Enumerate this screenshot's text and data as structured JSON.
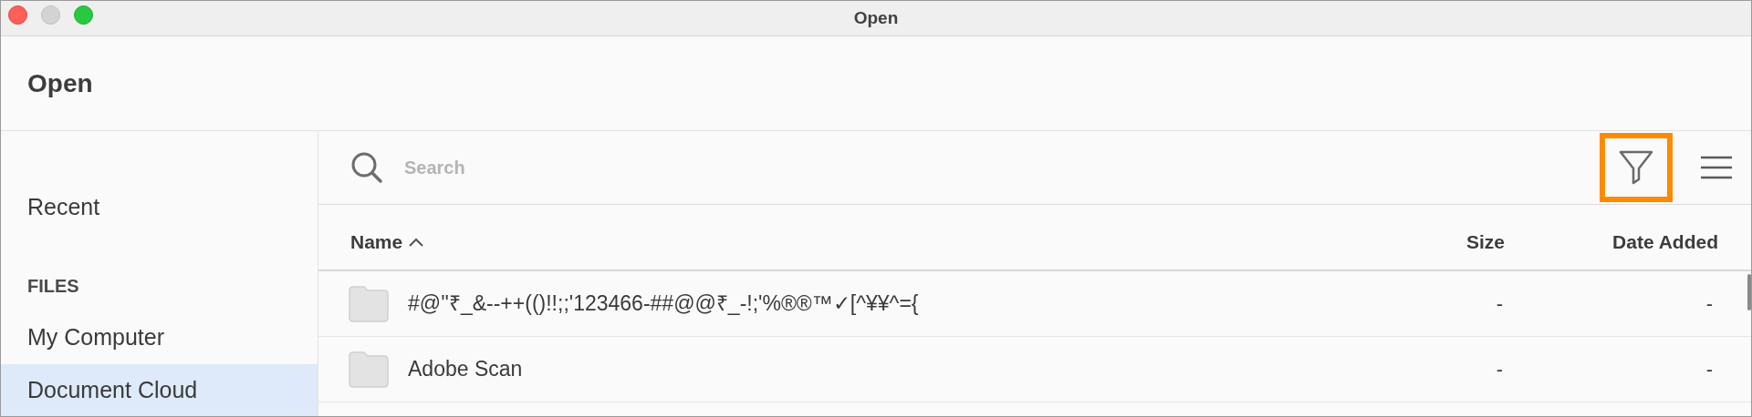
{
  "window": {
    "title": "Open"
  },
  "header": {
    "title": "Open"
  },
  "sidebar": {
    "items": [
      {
        "kind": "item",
        "label": "Recent",
        "selected": false
      },
      {
        "kind": "heading",
        "label": "FILES"
      },
      {
        "kind": "item",
        "label": "My Computer",
        "selected": false
      },
      {
        "kind": "item",
        "label": "Document Cloud",
        "selected": true
      }
    ]
  },
  "toolbar": {
    "search": {
      "placeholder": "Search"
    },
    "filter_button": {
      "highlighted": true
    }
  },
  "table": {
    "columns": [
      {
        "label": "Name",
        "sort_ascending": true
      },
      {
        "label": "Size"
      },
      {
        "label": "Date Added"
      }
    ],
    "rows": [
      {
        "kind": "folder",
        "name": "#@''₹_&--++(()!!;;'123466-##@@₹_-!;'%®®™✓[^¥¥^={",
        "size": "-",
        "date_added": "-"
      },
      {
        "kind": "folder",
        "name": "Adobe Scan",
        "size": "-",
        "date_added": "-"
      }
    ]
  }
}
